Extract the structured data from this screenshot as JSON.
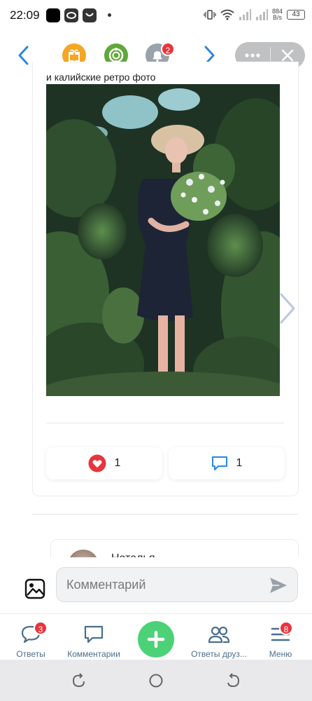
{
  "status_bar": {
    "time": "22:09",
    "net_speed_value": "884",
    "net_speed_unit": "B/s",
    "battery": "43"
  },
  "top_nav": {
    "notification_badge": "2"
  },
  "post": {
    "caption": "и калийские ретро фото",
    "likes": "1",
    "comments": "1"
  },
  "answer_preview": {
    "author": "Наталья"
  },
  "comment": {
    "placeholder": "Комментарий",
    "value": ""
  },
  "tabs": [
    {
      "label": "Ответы",
      "badge": "3",
      "icon": "chat-bubble-icon"
    },
    {
      "label": "Комментарии",
      "badge": "",
      "icon": "comment-icon"
    },
    {
      "label": "Ответы друз...",
      "badge": "",
      "icon": "friends-icon"
    },
    {
      "label": "Меню",
      "badge": "8",
      "icon": "menu-icon"
    }
  ],
  "colors": {
    "accent": "#2b86e4",
    "like": "#e8343c",
    "fab": "#4cd176",
    "badge": "#e8343c"
  }
}
